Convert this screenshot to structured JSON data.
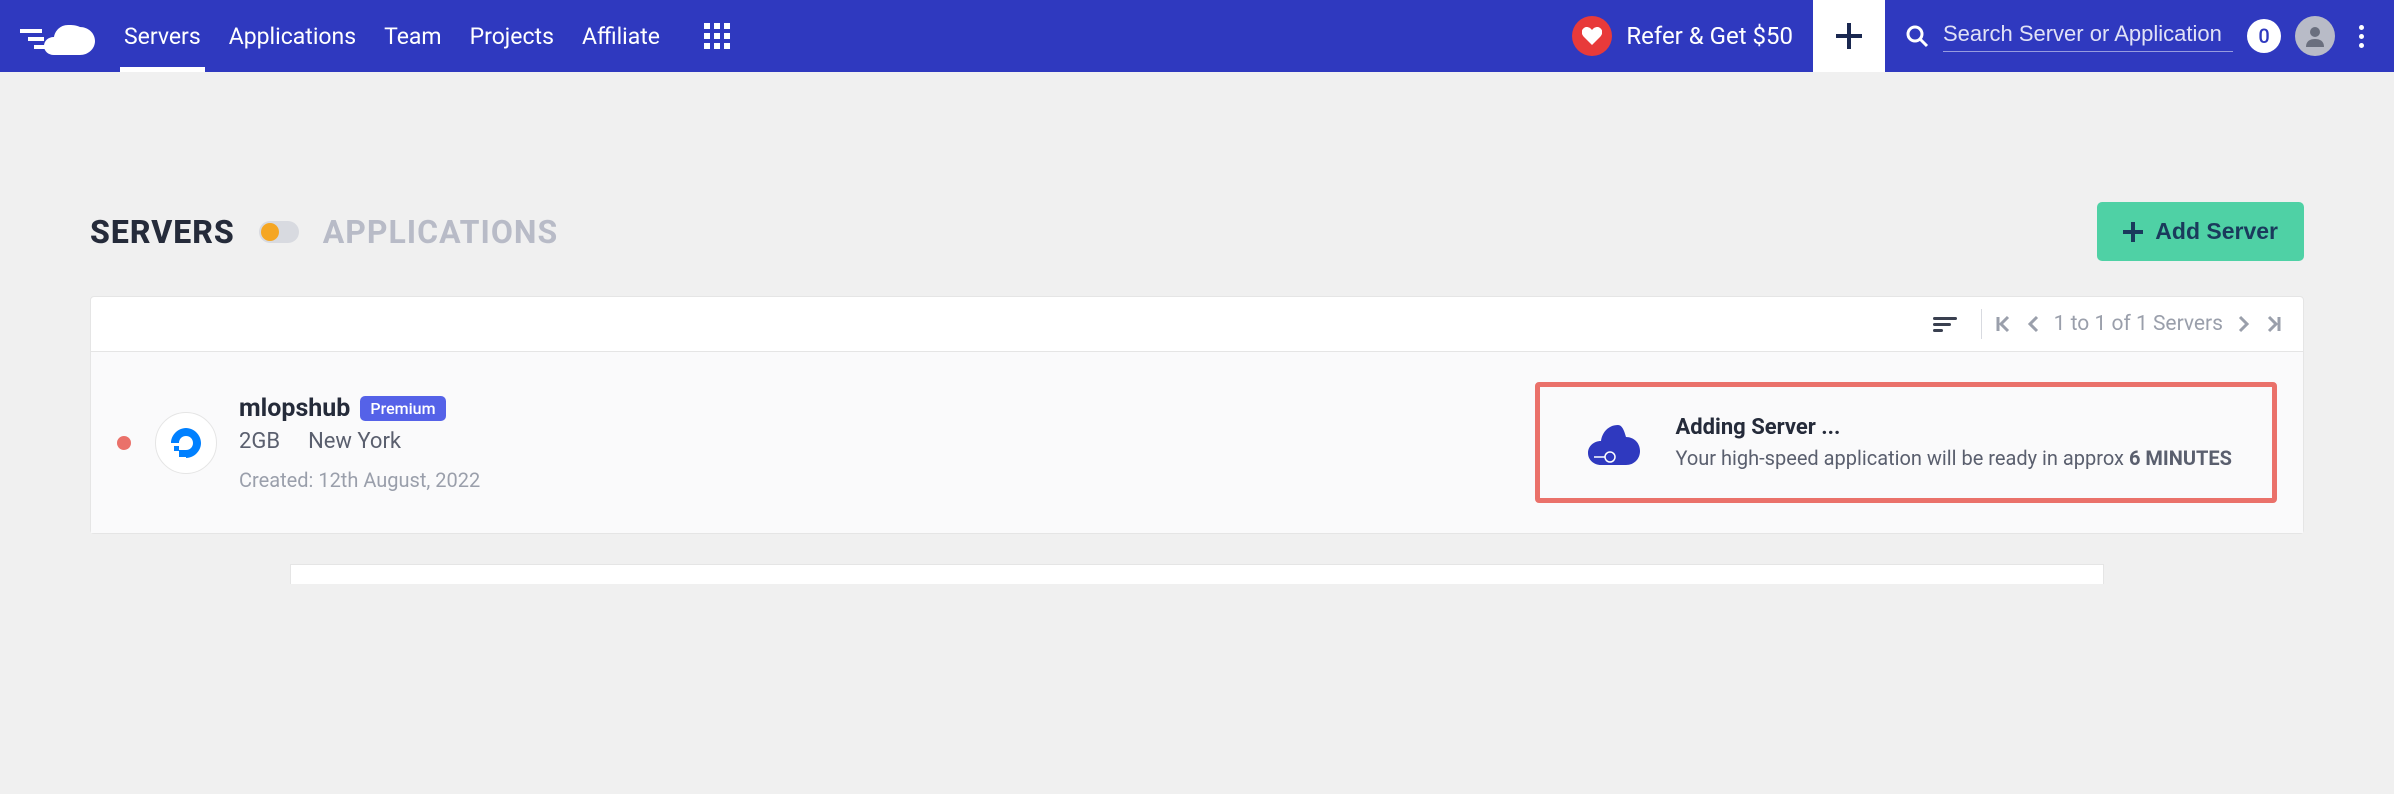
{
  "nav": {
    "servers": "Servers",
    "applications": "Applications",
    "team": "Team",
    "projects": "Projects",
    "affiliate": "Affiliate"
  },
  "refer": {
    "text": "Refer & Get $50"
  },
  "search": {
    "placeholder": "Search Server or Application",
    "count": "0"
  },
  "tabs": {
    "servers": "SERVERS",
    "applications": "APPLICATIONS"
  },
  "addServer": {
    "label": "Add Server"
  },
  "pagination": {
    "text": "1 to 1 of 1 Servers"
  },
  "server": {
    "name": "mlopshub",
    "badge": "Premium",
    "size": "2GB",
    "location": "New York",
    "created": "Created: 12th August, 2022"
  },
  "adding": {
    "title": "Adding Server ...",
    "subPrefix": "Your high-speed application will be ready in approx ",
    "eta": "6 MINUTES"
  }
}
